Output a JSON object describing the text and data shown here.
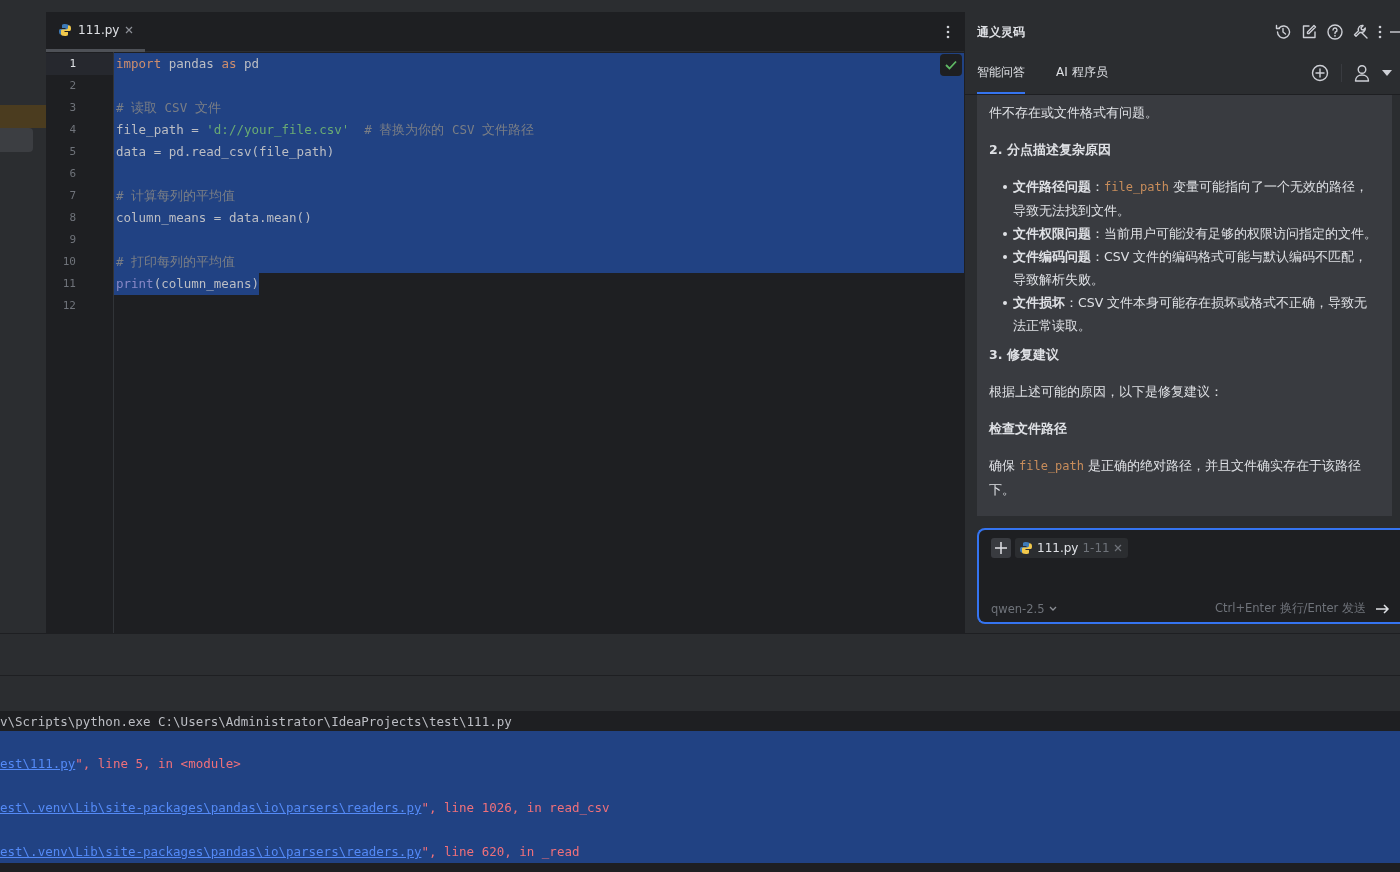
{
  "editor": {
    "tab": {
      "label": "111.py",
      "selected": true
    },
    "lines": [
      {
        "number": "1",
        "current": true,
        "selected": true,
        "whole_line": true,
        "tokens": [
          {
            "kind": "keyword",
            "text": "import"
          },
          {
            "kind": "plain",
            "text": " pandas "
          },
          {
            "kind": "keyword",
            "text": "as"
          },
          {
            "kind": "plain",
            "text": " pd"
          }
        ]
      },
      {
        "number": "2",
        "current": false,
        "selected": true,
        "whole_line": true
      },
      {
        "number": "3",
        "current": false,
        "selected": true,
        "whole_line": true,
        "tokens": [
          {
            "kind": "comment",
            "text": "# 读取 CSV 文件"
          }
        ]
      },
      {
        "number": "4",
        "current": false,
        "selected": true,
        "whole_line": true,
        "tokens": [
          {
            "kind": "plain",
            "text": "file_path = "
          },
          {
            "kind": "string",
            "text": "'d://your_file.csv'"
          },
          {
            "kind": "comment",
            "text": "  # 替换为你的 CSV 文件路径"
          }
        ]
      },
      {
        "number": "5",
        "current": false,
        "selected": true,
        "whole_line": true,
        "tokens": [
          {
            "kind": "plain",
            "text": "data = pd.read_csv(file_path)"
          }
        ]
      },
      {
        "number": "6",
        "current": false,
        "selected": true,
        "whole_line": true
      },
      {
        "number": "7",
        "current": false,
        "selected": true,
        "whole_line": true,
        "tokens": [
          {
            "kind": "comment",
            "text": "# 计算每列的平均值"
          }
        ]
      },
      {
        "number": "8",
        "current": false,
        "selected": true,
        "whole_line": true,
        "tokens": [
          {
            "kind": "plain",
            "text": "column_means = data.mean()"
          }
        ]
      },
      {
        "number": "9",
        "current": false,
        "selected": true,
        "whole_line": true
      },
      {
        "number": "10",
        "current": false,
        "selected": true,
        "whole_line": true,
        "tokens": [
          {
            "kind": "comment",
            "text": "# 打印每列的平均值"
          }
        ]
      },
      {
        "number": "11",
        "current": false,
        "selected": true,
        "whole_line": false,
        "tokens": [
          {
            "kind": "builtin",
            "text": "print"
          },
          {
            "kind": "plain",
            "text": "(column_means)"
          }
        ]
      },
      {
        "number": "12",
        "current": false,
        "selected": false
      }
    ]
  },
  "assistant": {
    "title": "通义灵码",
    "tabs": [
      {
        "label": "智能问答",
        "selected": true
      },
      {
        "label": "AI 程序员",
        "selected": false
      }
    ],
    "blocks": [
      {
        "kind": "text",
        "segments": [
          {
            "kind": "text",
            "text": "件不存在或文件格式有问题。"
          }
        ]
      },
      {
        "kind": "heading",
        "segments": [
          {
            "kind": "text",
            "text": "2. 分点描述复杂原因"
          }
        ]
      },
      {
        "kind": "bullet",
        "segments": [
          {
            "kind": "bold",
            "text": "文件路径问题"
          },
          {
            "kind": "text",
            "text": "："
          },
          {
            "kind": "code",
            "text": "file_path"
          },
          {
            "kind": "text",
            "text": " 变量可能指向了一个无效的路径，导致无法找到文件。"
          }
        ]
      },
      {
        "kind": "bullet",
        "segments": [
          {
            "kind": "bold",
            "text": "文件权限问题"
          },
          {
            "kind": "text",
            "text": "：当前用户可能没有足够的权限访问指定的文件。"
          }
        ]
      },
      {
        "kind": "bullet",
        "segments": [
          {
            "kind": "bold",
            "text": "文件编码问题"
          },
          {
            "kind": "text",
            "text": "：CSV 文件的编码格式可能与默认编码不匹配，导致解析失败。"
          }
        ]
      },
      {
        "kind": "bullet",
        "segments": [
          {
            "kind": "bold",
            "text": "文件损坏"
          },
          {
            "kind": "text",
            "text": "：CSV 文件本身可能存在损坏或格式不正确，导致无法正常读取。"
          }
        ]
      },
      {
        "kind": "heading",
        "segments": [
          {
            "kind": "text",
            "text": "3. 修复建议"
          }
        ]
      },
      {
        "kind": "text",
        "segments": [
          {
            "kind": "text",
            "text": "根据上述可能的原因，以下是修复建议："
          }
        ]
      },
      {
        "kind": "subheading",
        "segments": [
          {
            "kind": "text",
            "text": "检查文件路径"
          }
        ]
      },
      {
        "kind": "text",
        "segments": [
          {
            "kind": "text",
            "text": "确保 "
          },
          {
            "kind": "code",
            "text": "file_path"
          },
          {
            "kind": "text",
            "text": " 是正确的绝对路径，并且文件确实存在于该路径下。"
          }
        ]
      }
    ],
    "input": {
      "attachment": {
        "name": "111.py",
        "range": "1-11"
      },
      "model": "qwen-2.5",
      "hint": "Ctrl+Enter 换行/Enter 发送"
    }
  },
  "console": {
    "lines": [
      {
        "selected": false,
        "segments": [
          {
            "kind": "plain",
            "text": "v\\Scripts\\python.exe C:\\Users\\Administrator\\IdeaProjects\\test\\111.py"
          }
        ]
      },
      {
        "selected": true,
        "segments": [
          {
            "kind": "link",
            "text": "est\\111.py"
          },
          {
            "kind": "error",
            "text": "\", line 5, in <module>"
          }
        ]
      },
      {
        "selected": true,
        "segments": [
          {
            "kind": "link",
            "text": "est\\.venv\\Lib\\site-packages\\pandas\\io\\parsers\\readers.py"
          },
          {
            "kind": "error",
            "text": "\", line 1026, in read_csv"
          }
        ]
      },
      {
        "selected": true,
        "segments": [
          {
            "kind": "link",
            "text": "est\\.venv\\Lib\\site-packages\\pandas\\io\\parsers\\readers.py"
          },
          {
            "kind": "error",
            "text": "\", line 620, in _read"
          }
        ]
      }
    ]
  }
}
